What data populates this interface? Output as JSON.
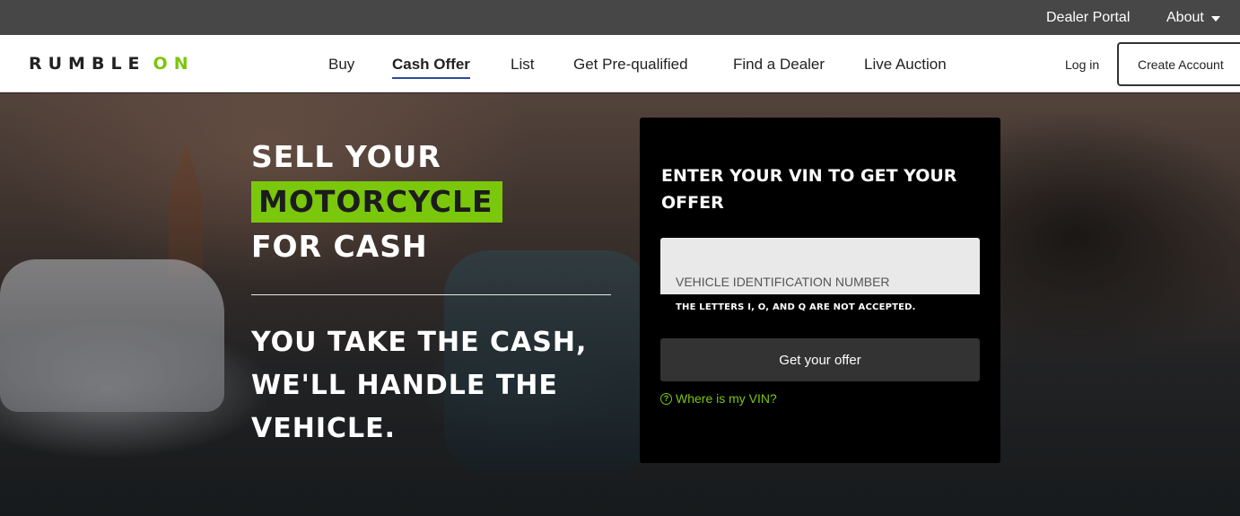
{
  "topbar": {
    "dealer_portal": "Dealer Portal",
    "about": "About"
  },
  "brand": {
    "logo_main": "RUMBLE",
    "logo_accent": "ON",
    "accent_color": "#7ac70c"
  },
  "nav": {
    "items": [
      "Buy",
      "Cash Offer",
      "List",
      "Get Pre-qualified",
      "Find a Dealer",
      "Live Auction"
    ],
    "active": "Cash Offer",
    "login": "Log in",
    "create_account": "Create Account"
  },
  "hero": {
    "line1": "SELL YOUR",
    "highlight": "MOTORCYCLE",
    "line3": "FOR CASH",
    "tagline1": "YOU TAKE THE CASH,",
    "tagline2": "WE'LL HANDLE THE",
    "tagline3": "VEHICLE."
  },
  "form": {
    "title": "ENTER YOUR VIN TO GET YOUR OFFER",
    "vin_placeholder": "VEHICLE IDENTIFICATION NUMBER",
    "vin_value": "",
    "hint": "THE LETTERS I, O, AND Q ARE NOT ACCEPTED.",
    "submit": "Get your offer",
    "help_icon": "question-circle-icon",
    "help_link": "Where is my VIN?"
  }
}
